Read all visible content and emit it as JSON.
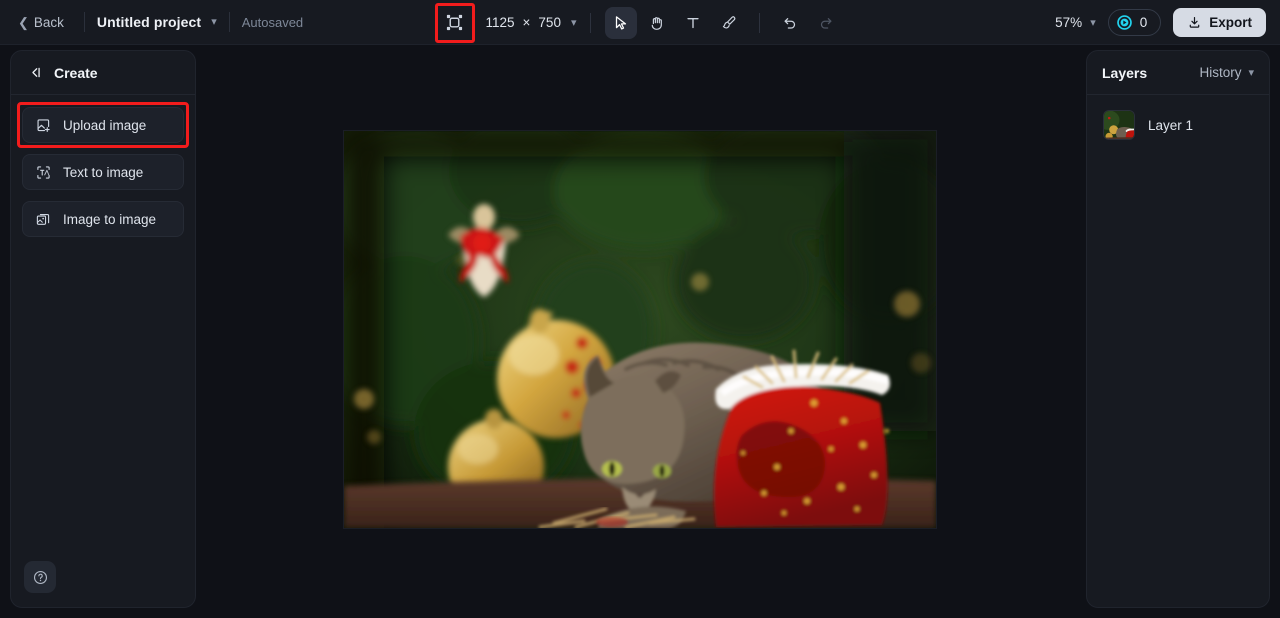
{
  "topbar": {
    "back_label": "Back",
    "project_title": "Untitled project",
    "project_caret": "∨",
    "autosaved_label": "Autosaved",
    "resize_icon": "resize-icon",
    "canvas_width": "1125",
    "canvas_size_separator": "×",
    "canvas_height": "750",
    "size_caret": "∨",
    "tools": [
      {
        "name": "select-tool",
        "icon": "cursor-arrow-icon",
        "active": true
      },
      {
        "name": "hand-tool",
        "icon": "hand-icon",
        "active": false
      },
      {
        "name": "text-tool",
        "icon": "text-t-icon",
        "active": false
      },
      {
        "name": "brush-tool",
        "icon": "brush-icon",
        "active": false
      }
    ],
    "undo_icon": "undo-arrow-icon",
    "redo_icon": "redo-arrow-icon",
    "zoom_level": "57%",
    "zoom_caret": "∨",
    "credits_count": "0",
    "credits_icon": "credit-coin-icon",
    "export_label": "Export",
    "export_icon": "download-icon"
  },
  "sidebar": {
    "header_label": "Create",
    "collapse_icon": "collapse-panel-icon",
    "items": [
      {
        "label": "Upload image",
        "icon": "image-upload-icon",
        "highlighted": true
      },
      {
        "label": "Text to image",
        "icon": "text-to-image-icon",
        "highlighted": false
      },
      {
        "label": "Image to image",
        "icon": "image-to-image-icon",
        "highlighted": false
      }
    ],
    "help_icon": "help-circle-icon"
  },
  "right_panel": {
    "layers_tab": "Layers",
    "history_tab": "History",
    "history_caret": "∨",
    "layers": [
      {
        "name": "Layer 1",
        "thumbnail": "christmas-cat-thumbnail"
      }
    ]
  },
  "canvas": {
    "artboard_alt": "christmas-cat-photo",
    "description": "Tabby cat beside a red Santa sack with white fur trim in front of a Christmas tree with gold ornaments"
  },
  "colors": {
    "accent_highlight": "#f21c1c",
    "credit_accent": "#22d3ee",
    "export_bg": "#d6dbe4",
    "panel_bg": "#171a21",
    "page_bg": "#0f1117"
  }
}
